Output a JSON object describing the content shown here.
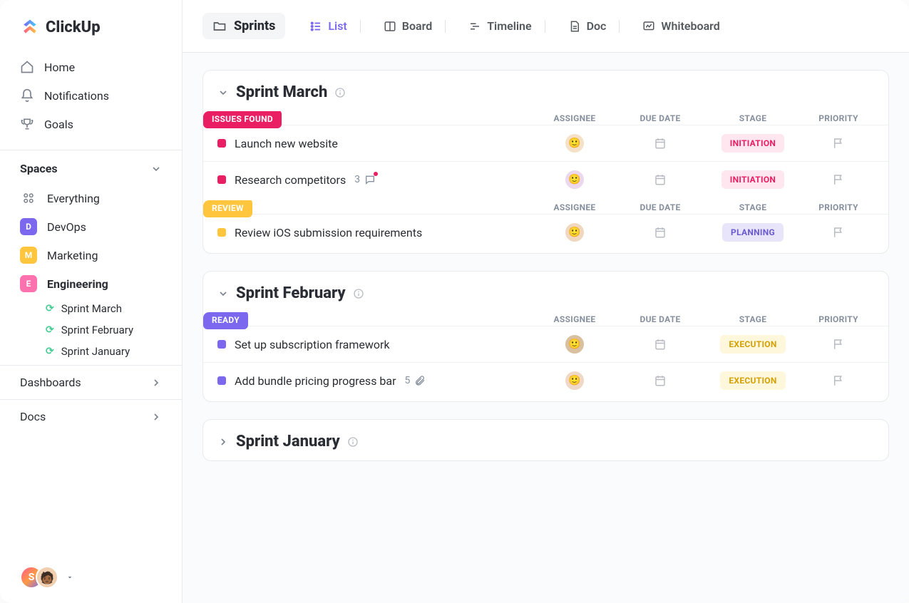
{
  "logo": "ClickUp",
  "nav": {
    "home": "Home",
    "notifications": "Notifications",
    "goals": "Goals"
  },
  "spaces": {
    "header": "Spaces",
    "everything": "Everything",
    "items": [
      {
        "letter": "D",
        "label": "DevOps",
        "color": "#7b68ee"
      },
      {
        "letter": "M",
        "label": "Marketing",
        "color": "#ffc53d"
      },
      {
        "letter": "E",
        "label": "Engineering",
        "color": "#fd71af"
      }
    ],
    "sprints": [
      "Sprint  March",
      "Sprint  February",
      "Sprint January"
    ]
  },
  "sections": {
    "dashboards": "Dashboards",
    "docs": "Docs"
  },
  "footer": {
    "avatar_letter": "S"
  },
  "breadcrumb": "Sprints",
  "views": {
    "list": "List",
    "board": "Board",
    "timeline": "Timeline",
    "doc": "Doc",
    "whiteboard": "Whiteboard"
  },
  "columns": {
    "assignee": "ASSIGNEE",
    "due": "DUE DATE",
    "stage": "STAGE",
    "priority": "PRIORITY"
  },
  "sprints_data": [
    {
      "title": "Sprint March",
      "expanded": true,
      "groups": [
        {
          "status": "ISSUES FOUND",
          "status_color": "#e91e63",
          "tasks": [
            {
              "title": "Launch new website",
              "sq": "#e91e63",
              "stage": "INITIATION",
              "stage_bg": "#ffe6ef",
              "stage_fg": "#e91e63",
              "avatar_bg": "#f5e1c8"
            },
            {
              "title": "Research competitors",
              "sq": "#e91e63",
              "count": "3",
              "chat": true,
              "stage": "INITIATION",
              "stage_bg": "#ffe6ef",
              "stage_fg": "#e91e63",
              "avatar_bg": "#ecd8ee"
            }
          ]
        },
        {
          "status": "REVIEW",
          "status_color": "#ffc53d",
          "tasks": [
            {
              "title": "Review iOS submission requirements",
              "sq": "#ffc53d",
              "stage": "PLANNING",
              "stage_bg": "#e8e5fb",
              "stage_fg": "#6a5acd",
              "avatar_bg": "#f0d8c0"
            }
          ]
        }
      ]
    },
    {
      "title": "Sprint February",
      "expanded": true,
      "groups": [
        {
          "status": "READY",
          "status_color": "#7b68ee",
          "tasks": [
            {
              "title": "Set up subscription framework",
              "sq": "#7b68ee",
              "stage": "EXECUTION",
              "stage_bg": "#fff7db",
              "stage_fg": "#d4a000",
              "avatar_bg": "#d8c0a0"
            },
            {
              "title": "Add bundle pricing progress bar",
              "sq": "#7b68ee",
              "count": "5",
              "attach": true,
              "stage": "EXECUTION",
              "stage_bg": "#fff7db",
              "stage_fg": "#d4a000",
              "avatar_bg": "#f0d8c8"
            }
          ]
        }
      ]
    },
    {
      "title": "Sprint January",
      "expanded": false,
      "groups": []
    }
  ]
}
